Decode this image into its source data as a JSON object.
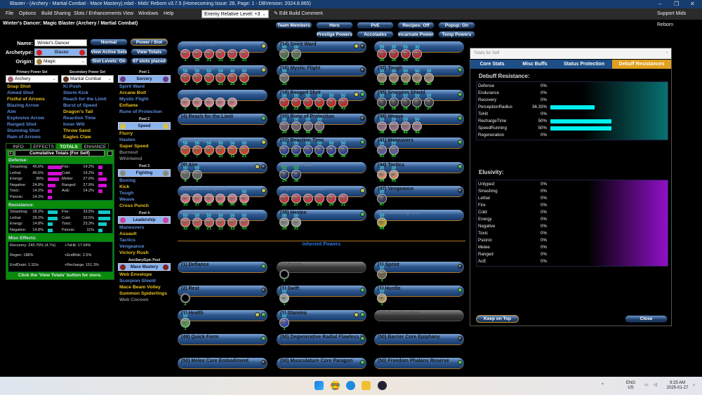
{
  "window": {
    "title": "Blaster - (Archery - Martial Combat - Mace Mastery).mbd - Mids' Reborn v3.7.5  (Homecoming Issue: 28, Page: 1 - DBVersion: 2024.8.865)",
    "minimize": "–",
    "maximize": "❐",
    "close": "✕"
  },
  "menu": {
    "items": [
      "File",
      "Options",
      "Build Sharing",
      "Slots / Enhancements",
      "View",
      "Windows",
      "Help"
    ],
    "level_select": "Enemy Relative Level: +3",
    "edit_comment": "Edit Build Comment",
    "support": "Support Mids Reborn"
  },
  "build_title": "Winter's Dancer: Magic Blaster (Archery / Martial Combat)",
  "character": {
    "name_label": "Name:",
    "name": "Winter's Dancer",
    "archetype_label": "Archetype:",
    "archetype": "Blaster",
    "origin_label": "Origin:",
    "origin": "Magic"
  },
  "buttons": {
    "normal": "Normal",
    "power_slot": "Power / Slot",
    "view_active_sets": "View Active Sets",
    "view_totals": "View Totals",
    "slot_levels": "Slot Levels: On",
    "slots_placed": "67 slots placed",
    "team_members": "Team Members",
    "hero": "Hero",
    "pve": "PvE",
    "recipes": "Recipes: Off",
    "popup": "Popup: On",
    "prestige": "Prestige Powers",
    "accolades": "Accolades",
    "incarnate": "Incarnate Powers",
    "temp": "Temp Powers"
  },
  "sets": {
    "primary": {
      "label": "Primary Power Set",
      "value": "Archery",
      "items": [
        {
          "n": "Snap Shot",
          "c": "y"
        },
        {
          "n": "Aimed Shot",
          "c": "b"
        },
        {
          "n": "Fistful of Arrows",
          "c": "y"
        },
        {
          "n": "Blazing Arrow",
          "c": "b"
        },
        {
          "n": "Aim",
          "c": "b"
        },
        {
          "n": "Explosive Arrow",
          "c": "b"
        },
        {
          "n": "Ranged Shot",
          "c": "b"
        },
        {
          "n": "Stunning Shot",
          "c": "b"
        },
        {
          "n": "Rain of Arrows",
          "c": "b"
        }
      ]
    },
    "secondary": {
      "label": "Secondary Power Set",
      "value": "Martial Combat",
      "items": [
        {
          "n": "Ki Push",
          "c": "b"
        },
        {
          "n": "Storm Kick",
          "c": "b"
        },
        {
          "n": "Reach for the Limit",
          "c": "b"
        },
        {
          "n": "Burst of Speed",
          "c": "b"
        },
        {
          "n": "Dragon's Tail",
          "c": "y"
        },
        {
          "n": "Reaction Time",
          "c": "b"
        },
        {
          "n": "Inner Will",
          "c": "b"
        },
        {
          "n": "Throw Sand",
          "c": "y"
        },
        {
          "n": "Eagles Claw",
          "c": "y"
        }
      ]
    },
    "pools": [
      {
        "label": "Pool 1",
        "name": "Sorcery",
        "icon": "#6a3a8a",
        "items": [
          {
            "n": "Spirit Ward",
            "c": "b"
          },
          {
            "n": "Arcane Bolt",
            "c": "y"
          },
          {
            "n": "Mystic Flight",
            "c": "b"
          },
          {
            "n": "Enflame",
            "c": "y"
          },
          {
            "n": "Rune of Protection",
            "c": "b"
          }
        ]
      },
      {
        "label": "Pool 2",
        "name": "Speed",
        "icon": "#d8c040",
        "items": [
          {
            "n": "Flurry",
            "c": "y"
          },
          {
            "n": "Hasten",
            "c": "b"
          },
          {
            "n": "Super Speed",
            "c": "y"
          },
          {
            "n": "Burnout",
            "c": "g"
          },
          {
            "n": "Whirlwind",
            "c": "g"
          }
        ]
      },
      {
        "label": "Pool 3",
        "name": "Fighting",
        "icon": "#8a8a7a",
        "items": [
          {
            "n": "Boxing",
            "c": "b"
          },
          {
            "n": "Kick",
            "c": "y"
          },
          {
            "n": "Tough",
            "c": "b"
          },
          {
            "n": "Weave",
            "c": "b"
          },
          {
            "n": "Cross Punch",
            "c": "y"
          }
        ]
      },
      {
        "label": "Pool 4",
        "name": "Leadership",
        "icon": "#d040a0",
        "items": [
          {
            "n": "Maneuvers",
            "c": "b"
          },
          {
            "n": "Assault",
            "c": "y"
          },
          {
            "n": "Tactics",
            "c": "b"
          },
          {
            "n": "Vengeance",
            "c": "b"
          },
          {
            "n": "Victory Rush",
            "c": "y"
          }
        ]
      },
      {
        "label": "Ancillary/Epic Pool",
        "name": "Mace Mastery",
        "icon": "#802020",
        "items": [
          {
            "n": "Web Envelope",
            "c": "y"
          },
          {
            "n": "Scorpion Shield",
            "c": "b"
          },
          {
            "n": "Mace Beam Volley",
            "c": "y"
          },
          {
            "n": "Summon Spiderlings",
            "c": "y"
          },
          {
            "n": "Web Cocoon",
            "c": "g"
          }
        ]
      }
    ]
  },
  "info_tabs": [
    "INFO",
    "EFFECTS",
    "TOTALS",
    "ENHANCE"
  ],
  "totals": {
    "title": "Cumulative Totals (For Self)",
    "f_btn": "F",
    "defense_label": "Defense:",
    "resistance_label": "Resistance:",
    "misc_label": "Misc Effects:",
    "defense": [
      {
        "n": "Smashing:",
        "v": "45.6%",
        "p": 45.6
      },
      {
        "n": "Lethal:",
        "v": "45.6%",
        "p": 45.6
      },
      {
        "n": "Energy:",
        "v": "36%",
        "p": 36
      },
      {
        "n": "Negative:",
        "v": "24.8%",
        "p": 24.8
      },
      {
        "n": "Toxic:",
        "v": "14.2%",
        "p": 14.2
      },
      {
        "n": "Psionic:",
        "v": "14.2%",
        "p": 14.2
      },
      {
        "n": "Fire:",
        "v": "14.2%",
        "p": 14.2
      },
      {
        "n": "Cold:",
        "v": "14.2%",
        "p": 14.2
      },
      {
        "n": "Melee:",
        "v": "27.6%",
        "p": 27.6
      },
      {
        "n": "Ranged:",
        "v": "27.9%",
        "p": 27.9
      },
      {
        "n": "AoE:",
        "v": "14.2%",
        "p": 14.2
      }
    ],
    "resistance": [
      {
        "n": "Smashing:",
        "v": "28.2%",
        "p": 28.2
      },
      {
        "n": "Lethal:",
        "v": "28.2%",
        "p": 28.2
      },
      {
        "n": "Energy:",
        "v": "14.8%",
        "p": 14.8
      },
      {
        "n": "Negative:",
        "v": "14.8%",
        "p": 14.8
      },
      {
        "n": "Fire:",
        "v": "33.5%",
        "p": 33.5
      },
      {
        "n": "Cold:",
        "v": "33.5%",
        "p": 33.5
      },
      {
        "n": "Toxic:",
        "v": "23.3%",
        "p": 23.3
      },
      {
        "n": "Psionic:",
        "v": "11%",
        "p": 11
      }
    ],
    "misc": [
      "Recovery: 243.75% (4.7/s)",
      "+ToHit: 17.54%",
      "Regen: 188%",
      "+EndRdx: 2.5%",
      "EndDrain: 1.52/s",
      "+Recharge: 151.3%"
    ],
    "footer": "Click the 'View Totals' button for more."
  },
  "powers": [
    {
      "l": "(1) Aimed Shot",
      "d": 1,
      "dots": [
        "y"
      ],
      "c": "#d83040",
      "e": [
        [
          "",
          1
        ],
        [
          "",
          15
        ],
        [
          "",
          31
        ],
        [
          "",
          33
        ],
        [
          "",
          33
        ],
        [
          "",
          33
        ]
      ]
    },
    {
      "l": "(1) Storm Kick",
      "d": 1,
      "dots": [
        "y"
      ],
      "c": "#c83030",
      "e": [
        [
          "50",
          1
        ],
        [
          "50",
          7
        ],
        [
          "50",
          17
        ],
        [
          "50",
          23
        ],
        [
          "40",
          25
        ],
        [
          "50",
          25
        ]
      ]
    },
    {
      "l": "(2) Ki Push",
      "d": 1,
      "dots": [],
      "c": "#e08090",
      "e": [
        [
          "",
          2
        ],
        [
          "",
          3
        ],
        [
          "",
          3
        ],
        [
          "",
          5
        ],
        [
          "",
          5
        ]
      ]
    },
    {
      "l": "(4) Reach for the Limit",
      "d": 0,
      "dots": [
        "g"
      ],
      "c": "",
      "e": []
    },
    {
      "l": "(6) Blazing Arrow",
      "d": 1,
      "dots": [
        "y"
      ],
      "c": "#d84020",
      "e": [
        [
          "50",
          6
        ],
        [
          "50",
          7
        ],
        [
          "50",
          9
        ],
        [
          "50",
          11
        ],
        [
          "50",
          11
        ],
        [
          "50",
          21
        ]
      ]
    },
    {
      "l": "(8) Aim",
      "d": 0,
      "dots": [
        "y",
        "k"
      ],
      "c": "#606060",
      "e": [
        [
          "50",
          8
        ],
        [
          "50",
          9
        ]
      ]
    },
    {
      "l": "(10) Burst of Speed",
      "d": 1,
      "dots": [
        "y"
      ],
      "c": "#e07080",
      "e": [
        [
          "",
          10
        ],
        [
          "",
          17
        ],
        [
          "",
          45
        ],
        [
          "",
          46
        ],
        [
          "",
          50
        ],
        [
          "50",
          48
        ]
      ]
    },
    {
      "l": "(12) Explosive Arrow",
      "d": 1,
      "dots": [],
      "c": "#d05050",
      "e": [
        [
          "50",
          12
        ],
        [
          "50",
          15
        ],
        [
          "50",
          21
        ],
        [
          "50",
          13
        ],
        [
          "50",
          13
        ],
        [
          "50",
          43
        ]
      ]
    },
    {
      "l": "(14) Spirit Ward",
      "d": 0,
      "dots": [
        "y",
        "k"
      ],
      "c": "#507050",
      "e": [
        [
          "50",
          14
        ],
        [
          "50",
          37
        ]
      ]
    },
    {
      "l": "(16) Mystic Flight",
      "d": 0,
      "dots": [
        "k"
      ],
      "c": "#707070",
      "e": [
        [
          "50",
          16
        ]
      ]
    },
    {
      "l": "(18) Ranged Shot",
      "d": 0,
      "dots": [
        "y",
        "g"
      ],
      "c": "#d02020",
      "e": [
        [
          "50",
          18
        ],
        [
          "50",
          23
        ],
        [
          "50",
          40
        ],
        [
          "50",
          19
        ],
        [
          "50",
          19
        ],
        [
          "50",
          43
        ]
      ]
    },
    {
      "l": "(20) Rune of Protection",
      "d": 0,
      "dots": [
        "k"
      ],
      "c": "#705a70",
      "e": [
        [
          "50",
          20
        ],
        [
          "50",
          42
        ],
        [
          "50",
          48
        ],
        [
          "50",
          48
        ]
      ]
    },
    {
      "l": "(22) Reaction Time",
      "d": 0,
      "dots": [
        "g"
      ],
      "c": "#2a3a9a",
      "e": [
        [
          "50",
          22
        ],
        [
          "50",
          39
        ],
        [
          "50",
          42
        ],
        [
          "50",
          45
        ],
        [
          "50",
          46
        ],
        [
          "50",
          46
        ]
      ]
    },
    {
      "l": "(24) Inner Will",
      "d": 1,
      "dots": [],
      "c": "#1a2a6a",
      "e": [
        [
          "53",
          24
        ],
        [
          "53",
          38
        ]
      ]
    },
    {
      "l": "(26) Rain of Arrows",
      "d": 1,
      "dots": [
        "y"
      ],
      "c": "#d03040",
      "e": [
        [
          "",
          26
        ],
        [
          "",
          27
        ],
        [
          "",
          27
        ],
        [
          "",
          29
        ],
        [
          "",
          29
        ],
        [
          "",
          31
        ]
      ]
    },
    {
      "l": "(28) Hasten",
      "d": 0,
      "dots": [
        "g"
      ],
      "c": "#909090",
      "e": [
        [
          "50",
          28
        ],
        [
          "50",
          31
        ]
      ]
    },
    {
      "l": "(30) Boxing",
      "d": 1,
      "dots": [],
      "c": "#c02030",
      "e": [
        [
          "35",
          30
        ],
        [
          "35",
          34
        ],
        [
          "35",
          34
        ],
        [
          "35",
          40
        ]
      ]
    },
    {
      "l": "(32) Tough",
      "d": 0,
      "dots": [
        "g"
      ],
      "c": "#a08070",
      "e": [
        [
          "30",
          32
        ],
        [
          "30",
          34
        ],
        [
          "50",
          39
        ],
        [
          "50",
          39
        ],
        [
          "50",
          50
        ]
      ]
    },
    {
      "l": "(35) Scorpion Shield",
      "d": 0,
      "dots": [
        "g"
      ],
      "c": "#303040",
      "e": [
        [
          "50",
          35
        ],
        [
          "50",
          36
        ],
        [
          "50",
          36
        ],
        [
          "50",
          37
        ],
        [
          "50",
          37
        ]
      ]
    },
    {
      "l": "(38) Weave",
      "d": 0,
      "dots": [
        "g"
      ],
      "c": "#a07090",
      "e": [
        [
          "50",
          38
        ],
        [
          "30",
          40
        ],
        [
          "50",
          42
        ],
        [
          "50",
          43
        ]
      ]
    },
    {
      "l": "(41) Maneuvers",
      "d": 0,
      "dots": [
        "g"
      ],
      "c": "#5a5aa0",
      "e": [
        [
          "50",
          41
        ],
        [
          "50",
          50
        ]
      ]
    },
    {
      "l": "(44) Tactics",
      "d": 0,
      "dots": [
        "g"
      ],
      "c": "#e09070",
      "e": [
        [
          "30",
          44
        ],
        [
          "30",
          45
        ]
      ]
    },
    {
      "l": "(47) Vengeance",
      "d": 0,
      "dots": [
        "k"
      ],
      "c": "#303060",
      "e": [
        [
          "50",
          47
        ]
      ]
    },
    {
      "l": "(49) Stunning Shot",
      "d": 1,
      "dots": [],
      "c": "#c0a020",
      "e": [
        [
          "50",
          49
        ]
      ]
    }
  ],
  "inherent_title": "Inherent Powers",
  "inherent": [
    {
      "l": "(1) Defiance",
      "d": 0,
      "dots": [
        "g"
      ],
      "c": "",
      "e": []
    },
    {
      "l": "(1) Brawl",
      "d": 2,
      "dots": [],
      "c": "#000",
      "e": [
        [
          "",
          1
        ]
      ]
    },
    {
      "l": "(1) Sprint",
      "d": 0,
      "dots": [
        "k"
      ],
      "c": "#706040",
      "e": [
        [
          "50",
          1
        ]
      ]
    },
    {
      "l": "(2) Rest",
      "d": 0,
      "dots": [
        "k"
      ],
      "c": "#000",
      "e": [
        [
          "",
          2
        ]
      ]
    },
    {
      "l": "(1) Swift",
      "d": 0,
      "dots": [
        "g"
      ],
      "c": "#a0b0b0",
      "e": [
        [
          "50",
          1
        ]
      ]
    },
    {
      "l": "(1) Hurdle",
      "d": 0,
      "dots": [
        "g"
      ],
      "c": "#c0a060",
      "e": [
        [
          "50",
          1
        ]
      ]
    },
    {
      "l": "(1) Health",
      "d": 0,
      "dots": [
        "y",
        "g"
      ],
      "c": "#50a050",
      "e": [
        [
          "50",
          1
        ]
      ]
    },
    {
      "l": "(1) Stamina",
      "d": 0,
      "dots": [
        "y",
        "g"
      ],
      "c": "#3040b0",
      "e": [
        [
          "50",
          1
        ]
      ]
    },
    {
      "l": "(12) Translocation",
      "d": 2,
      "dots": [],
      "c": "",
      "e": []
    },
    {
      "l": "(49) Quick Form",
      "d": 0,
      "dots": [
        "g"
      ],
      "c": "",
      "e": []
    },
    {
      "l": "(50) Degenerative Radial Flawless Inter",
      "d": 0,
      "dots": [
        "g"
      ],
      "c": "",
      "e": []
    },
    {
      "l": "(50) Barrier Core Epiphany",
      "d": 0,
      "dots": [
        "k"
      ],
      "c": "",
      "e": []
    },
    {
      "l": "(50) Melee Core Embodiment",
      "d": 0,
      "dots": [
        "k"
      ],
      "c": "",
      "e": []
    },
    {
      "l": "(50) Musculature Core Paragon",
      "d": 0,
      "dots": [
        "g"
      ],
      "c": "",
      "e": []
    },
    {
      "l": "(50) Freedom Phalanx Reserve",
      "d": 0,
      "dots": [
        "g"
      ],
      "c": "",
      "e": []
    }
  ],
  "dialog": {
    "title": "Totals for Self",
    "close": "×",
    "tabs": [
      "Core Stats",
      "Misc Buffs",
      "Status Protection",
      "Debuff Resistances"
    ],
    "debuff_label": "Debuff Resistance:",
    "debuff": [
      {
        "n": "Defense",
        "v": "0%",
        "p": 0
      },
      {
        "n": "Endurance",
        "v": "0%",
        "p": 0
      },
      {
        "n": "Recovery",
        "v": "0%",
        "p": 0
      },
      {
        "n": "PerceptionRadius",
        "v": "36.33%",
        "p": 36.33
      },
      {
        "n": "ToHit",
        "v": "0%",
        "p": 0
      },
      {
        "n": "RechargeTime",
        "v": "50%",
        "p": 50
      },
      {
        "n": "SpeedRunning",
        "v": "50%",
        "p": 50
      },
      {
        "n": "Regeneration",
        "v": "0%",
        "p": 0
      }
    ],
    "elusivity_label": "Elusivity:",
    "elusivity": [
      {
        "n": "Untyped",
        "v": "0%"
      },
      {
        "n": "Smashing",
        "v": "0%"
      },
      {
        "n": "Lethal",
        "v": "0%"
      },
      {
        "n": "Fire",
        "v": "0%"
      },
      {
        "n": "Cold",
        "v": "0%"
      },
      {
        "n": "Energy",
        "v": "0%"
      },
      {
        "n": "Negative",
        "v": "0%"
      },
      {
        "n": "Toxic",
        "v": "0%"
      },
      {
        "n": "Psionic",
        "v": "0%"
      },
      {
        "n": "Melee",
        "v": "0%"
      },
      {
        "n": "Ranged",
        "v": "0%"
      },
      {
        "n": "AoE",
        "v": "0%"
      }
    ],
    "keep_on_top": "Keep on Top",
    "close_btn": "Close"
  },
  "taskbar": {
    "lang1": "ENG",
    "lang2": "US",
    "time": "9:25 AM",
    "date": "2025-01-27",
    "chevron": "^"
  },
  "colors": {
    "yellow": "#e8c020",
    "blue": "#5f8fe0",
    "green_dot": "#20b020",
    "black_dot": "#222",
    "accent": "#e0a020"
  }
}
